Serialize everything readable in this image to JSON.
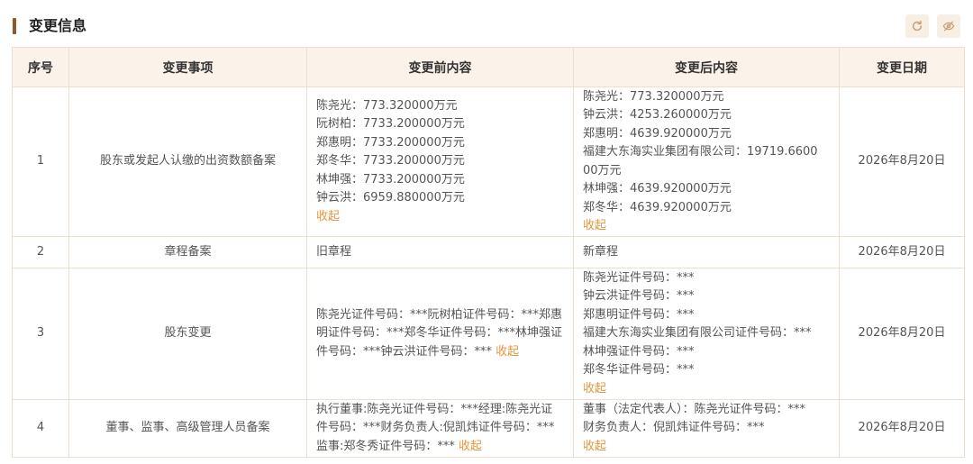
{
  "section": {
    "title": "变更信息",
    "colors": {
      "accent": "#8a5a2a",
      "header_bg": "#fbf3e9",
      "link": "#e9953b",
      "border": "#ecdfd0"
    },
    "icons": [
      "refresh-icon",
      "eye-hide-icon"
    ]
  },
  "table": {
    "headers": [
      "序号",
      "变更事项",
      "变更前内容",
      "变更后内容",
      "变更日期"
    ],
    "collapse_label": "收起",
    "rows": [
      {
        "index": "1",
        "item": "股东或发起人认缴的出资数额备案",
        "before": [
          "陈尧光：773.320000万元",
          "阮树柏：7733.200000万元",
          "郑惠明：7733.200000万元",
          "郑冬华：7733.200000万元",
          "林坤强：7733.200000万元",
          "钟云洪：6959.880000万元"
        ],
        "after": [
          "陈尧光：773.320000万元",
          "钟云洪：4253.260000万元",
          "郑惠明：4639.920000万元",
          "福建大东海实业集团有限公司：19719.6600",
          "00万元",
          "林坤强：4639.920000万元",
          "郑冬华：4639.920000万元"
        ],
        "date": "2026年8月20日"
      },
      {
        "index": "2",
        "item": "章程备案",
        "before_text": "旧章程",
        "after_text": "新章程",
        "date": "2026年8月20日"
      },
      {
        "index": "3",
        "item": "股东变更",
        "before_paragraph": "陈尧光证件号码：***阮树柏证件号码：***郑惠明证件号码：***郑冬华证件号码：***林坤强证件号码：***钟云洪证件号码：***",
        "after": [
          "陈尧光证件号码：***",
          "钟云洪证件号码：***",
          "郑惠明证件号码：***",
          "福建大东海实业集团有限公司证件号码：***",
          "林坤强证件号码：***",
          "郑冬华证件号码：***"
        ],
        "date": "2026年8月20日"
      },
      {
        "index": "4",
        "item": "董事、监事、高级管理人员备案",
        "before_paragraph": "执行董事:陈尧光证件号码：***经理:陈尧光证件号码：***财务负责人:倪凯炜证件号码：***监事:郑冬秀证件号码：***",
        "after": [
          "董事（法定代表人）：陈尧光证件号码：***",
          "财务负责人：倪凯炜证件号码：***"
        ],
        "date": "2026年8月20日"
      }
    ]
  }
}
